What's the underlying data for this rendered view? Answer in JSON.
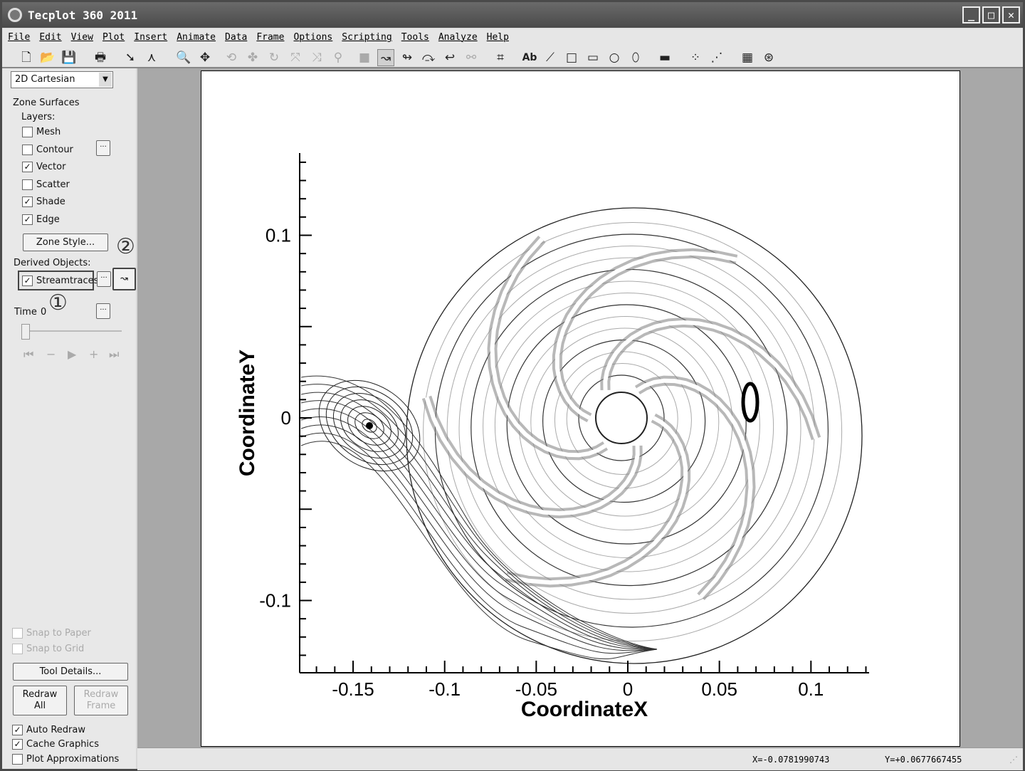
{
  "title": "Tecplot 360 2011",
  "menu": [
    "File",
    "Edit",
    "View",
    "Plot",
    "Insert",
    "Animate",
    "Data",
    "Frame",
    "Options",
    "Scripting",
    "Tools",
    "Analyze",
    "Help"
  ],
  "toolbar": {
    "text_tool": "Ab"
  },
  "sidebar": {
    "plot_type": "2D Cartesian",
    "zone_surfaces": "Zone Surfaces",
    "layers_label": "Layers:",
    "layers": [
      {
        "label": "Mesh",
        "checked": false
      },
      {
        "label": "Contour",
        "checked": false
      },
      {
        "label": "Vector",
        "checked": true
      },
      {
        "label": "Scatter",
        "checked": false
      },
      {
        "label": "Shade",
        "checked": true
      },
      {
        "label": "Edge",
        "checked": true
      }
    ],
    "zone_style": "Zone Style...",
    "derived_objects": "Derived Objects:",
    "streamtraces": "Streamtraces",
    "annotation_1": "①",
    "annotation_2": "②",
    "time_label": "Time",
    "time_value": "0",
    "snap_paper": "Snap to Paper",
    "snap_grid": "Snap to Grid",
    "tool_details": "Tool Details...",
    "redraw_all": "Redraw All",
    "redraw_frame": "Redraw Frame",
    "auto_redraw": "Auto Redraw",
    "cache_graphics": "Cache Graphics",
    "plot_approx": "Plot Approximations",
    "dots": "..."
  },
  "status": {
    "x": "X=-0.0781990743",
    "y": "Y=+0.0677667455"
  },
  "plot": {
    "xlabel": "CoordinateX",
    "ylabel": "CoordinateY",
    "xticks": [
      {
        "v": -0.15,
        "l": "-0.15"
      },
      {
        "v": -0.1,
        "l": "-0.1"
      },
      {
        "v": -0.05,
        "l": "-0.05"
      },
      {
        "v": 0,
        "l": "0"
      },
      {
        "v": 0.05,
        "l": "0.05"
      },
      {
        "v": 0.1,
        "l": "0.1"
      }
    ],
    "yticks": [
      {
        "v": 0.1,
        "l": "0.1"
      },
      {
        "v": 0,
        "l": "0"
      },
      {
        "v": -0.1,
        "l": "-0.1"
      }
    ],
    "xrange": [
      -0.179,
      0.132
    ],
    "yrange": [
      -0.139,
      0.145
    ]
  }
}
